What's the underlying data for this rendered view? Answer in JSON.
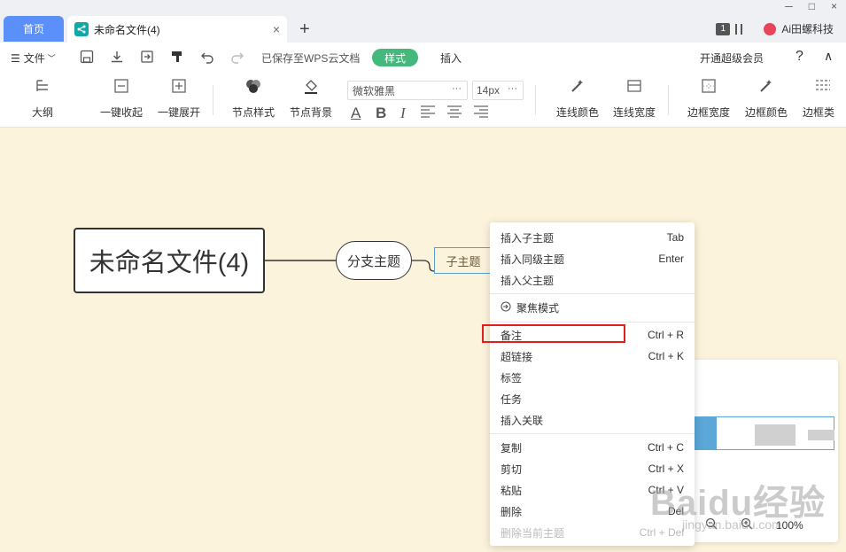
{
  "tabs": {
    "home": "首页",
    "doc_title": "未命名文件(4)",
    "close": "×",
    "add": "+"
  },
  "window": {
    "page_badge": "1",
    "account_name": "Ai田螺科技",
    "minimize": "─",
    "maximize": "□",
    "close": "×"
  },
  "menubar": {
    "file": "文件",
    "saved_status": "已保存至WPS云文档",
    "style_tab": "样式",
    "insert_tab": "插入",
    "vip_link": "开通超级会员",
    "help": "?",
    "collapse": "∧"
  },
  "ribbon": {
    "outline": "大纲",
    "collapse_all": "一键收起",
    "expand_all": "一键展开",
    "node_style": "节点样式",
    "node_bg": "节点背景",
    "font_name": "微软雅黑",
    "font_size": "14px",
    "line_color": "连线颜色",
    "line_width": "连线宽度",
    "border_width": "边框宽度",
    "border_color": "边框颜色",
    "border_type": "边框类"
  },
  "format_buttons": {
    "font_color": "A",
    "bold": "B",
    "italic": "I"
  },
  "mindmap": {
    "root": "未命名文件(4)",
    "branch": "分支主题",
    "sub": "子主题"
  },
  "context_menu": {
    "insert_child": "插入子主题",
    "insert_child_sc": "Tab",
    "insert_sibling": "插入同级主题",
    "insert_sibling_sc": "Enter",
    "insert_parent": "插入父主题",
    "focus_mode": "聚焦模式",
    "note": "备注",
    "note_sc": "Ctrl + R",
    "hyperlink": "超链接",
    "hyperlink_sc": "Ctrl + K",
    "tag": "标签",
    "task": "任务",
    "insert_relation": "插入关联",
    "copy": "复制",
    "copy_sc": "Ctrl + C",
    "cut": "剪切",
    "cut_sc": "Ctrl + X",
    "paste": "粘贴",
    "paste_sc": "Ctrl + V",
    "delete": "删除",
    "delete_sc": "Del",
    "delete_current": "删除当前主题",
    "delete_current_sc": "Ctrl + Del"
  },
  "minimap": {
    "zoom_level": "100%"
  },
  "watermark": {
    "brand": "Baidu经验",
    "url": "jingyan.baidu.com"
  },
  "colors": {
    "accent_blue": "#5b8ff9",
    "style_green": "#45b97c",
    "vip_green": "#1aaa5f",
    "highlight_red": "#e02020",
    "canvas_bg": "#fcf3dc"
  }
}
